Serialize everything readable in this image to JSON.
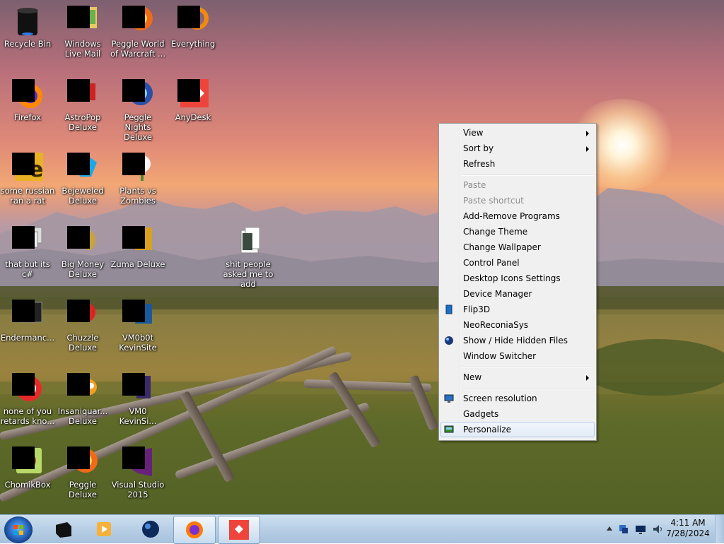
{
  "desktop_icons": [
    {
      "label": "Recycle Bin",
      "icon": "recycle-bin-icon"
    },
    {
      "label": "Windows Live Mail",
      "icon": "mail-icon"
    },
    {
      "label": "Peggle World of Warcraft ...",
      "icon": "peggle-icon"
    },
    {
      "label": "Everything",
      "icon": "search-icon"
    },
    {
      "label": "Firefox",
      "icon": "firefox-icon"
    },
    {
      "label": "AstroPop Deluxe",
      "icon": "astropop-icon"
    },
    {
      "label": "Peggle Nights Deluxe",
      "icon": "peggle-icon"
    },
    {
      "label": "AnyDesk",
      "icon": "anydesk-icon"
    },
    {
      "label": "some russian ran a rat",
      "icon": "app-icon"
    },
    {
      "label": "Bejeweled Deluxe",
      "icon": "gem-icon"
    },
    {
      "label": "Plants vs Zombies",
      "icon": "plant-icon"
    },
    {
      "label": "that but its c#",
      "icon": "app-icon"
    },
    {
      "label": "Big Money Deluxe",
      "icon": "money-icon"
    },
    {
      "label": "Zuma Deluxe",
      "icon": "zuma-icon"
    },
    {
      "label": "shit people asked me to add",
      "icon": "folder-icon"
    },
    {
      "label": "Endermanc...",
      "icon": "app-icon"
    },
    {
      "label": "Chuzzle Deluxe",
      "icon": "chuzzle-icon"
    },
    {
      "label": "VM0b0t KevinSite",
      "icon": "app-icon"
    },
    {
      "label": "none of you retards kno...",
      "icon": "app-icon"
    },
    {
      "label": "Insaniquar... Deluxe",
      "icon": "fish-icon"
    },
    {
      "label": "VM0 KevinSi...",
      "icon": "app-icon"
    },
    {
      "label": "ChomikBox",
      "icon": "app-icon"
    },
    {
      "label": "Peggle Deluxe",
      "icon": "peggle-icon"
    },
    {
      "label": "Visual Studio 2015",
      "icon": "visual-studio-icon"
    }
  ],
  "context_menu": {
    "items": [
      {
        "label": "View",
        "submenu": true
      },
      {
        "label": "Sort by",
        "submenu": true
      },
      {
        "label": "Refresh"
      },
      {
        "label": "Paste",
        "disabled": true
      },
      {
        "label": "Paste shortcut",
        "disabled": true
      },
      {
        "label": "Add-Remove Programs"
      },
      {
        "label": "Change Theme"
      },
      {
        "label": "Change Wallpaper"
      },
      {
        "label": "Control Panel"
      },
      {
        "label": "Desktop Icons Settings"
      },
      {
        "label": "Device Manager"
      },
      {
        "label": "Flip3D",
        "icon": "flip3d-icon"
      },
      {
        "label": "NeoReconiaSys"
      },
      {
        "label": "Show / Hide Hidden Files",
        "icon": "globe-icon"
      },
      {
        "label": "Window Switcher"
      },
      {
        "label": "New",
        "submenu": true
      },
      {
        "label": "Screen resolution",
        "icon": "screen-resolution-icon"
      },
      {
        "label": "Gadgets"
      },
      {
        "label": "Personalize",
        "icon": "personalize-icon",
        "highlighted": true
      }
    ]
  },
  "taskbar": {
    "start_button": "start-orb-icon",
    "pinned": [
      "app-icon",
      "media-player-icon",
      "globe-icon",
      "firefox-icon",
      "anydesk-icon"
    ],
    "tray_icons": [
      "show-hidden-icons-arrow",
      "network-icon",
      "monitor-icon",
      "volume-icon"
    ],
    "clock": {
      "time": "4:11 AM",
      "date": "7/28/2024"
    }
  },
  "colors": {
    "menu_bg": "#f0f0f0",
    "menu_highlight_border": "#aecaeb",
    "disabled_text": "#8d8d8d",
    "taskbar_bg": "#b9d0e6",
    "anydesk_red": "#ef443b"
  }
}
